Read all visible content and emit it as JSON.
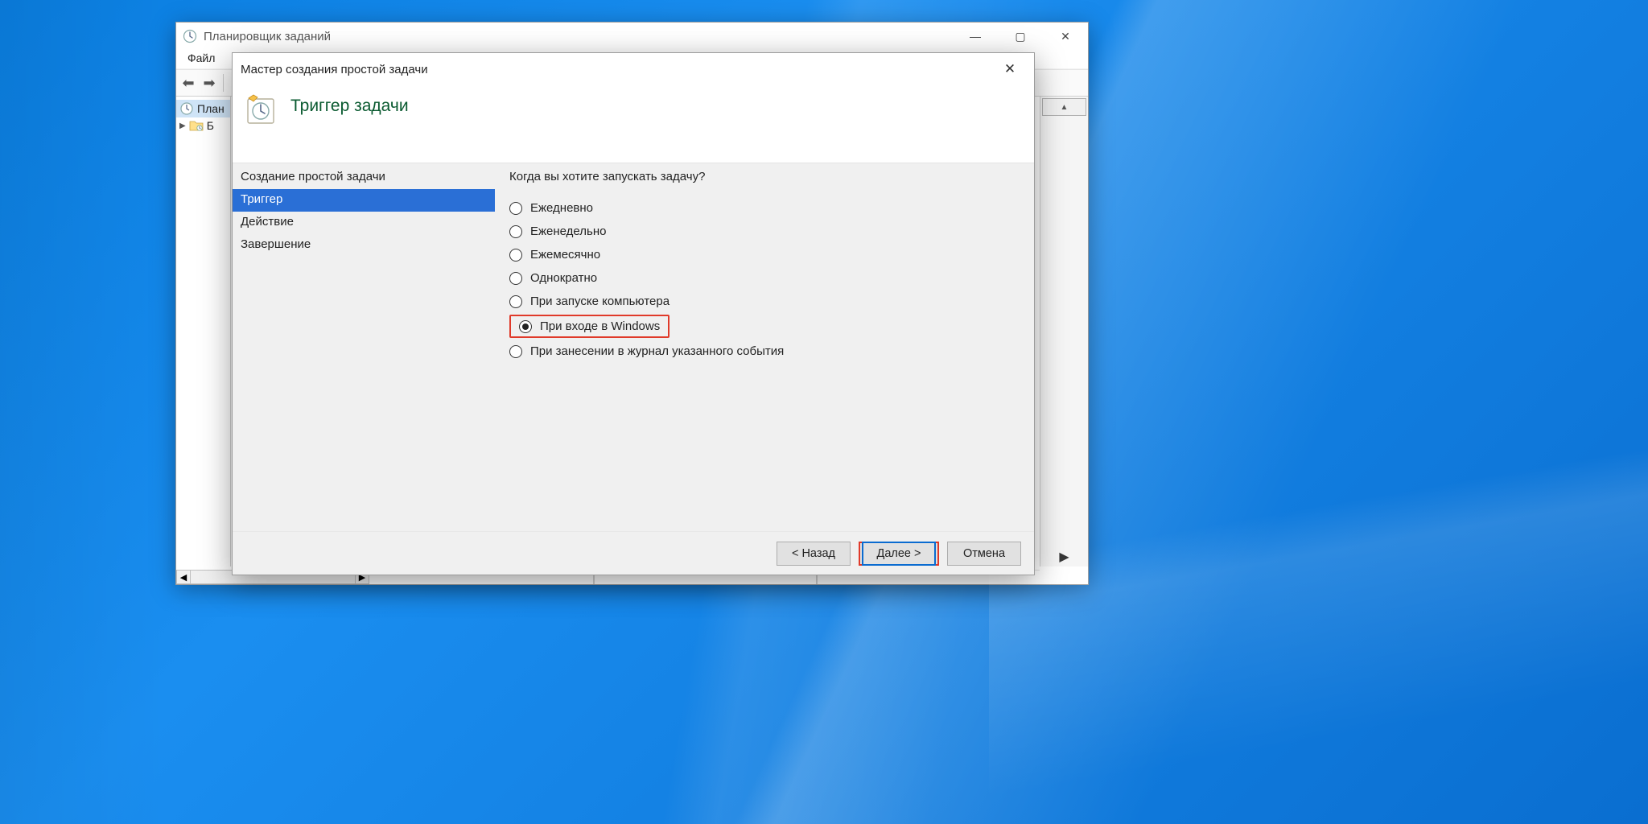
{
  "parent_window": {
    "title": "Планировщик заданий",
    "menu": {
      "file": "Файл"
    },
    "tree": {
      "item_root": "Планировщик заданий",
      "item_root_visible": "План",
      "item_lib": "Библиотека",
      "item_lib_visible": "Б"
    }
  },
  "wizard": {
    "title": "Мастер создания простой задачи",
    "header": "Триггер задачи",
    "nav": {
      "create": "Создание простой задачи",
      "trigger": "Триггер",
      "action": "Действие",
      "finish": "Завершение"
    },
    "question": "Когда вы хотите запускать задачу?",
    "options": {
      "daily": "Ежедневно",
      "weekly": "Еженедельно",
      "monthly": "Ежемесячно",
      "once": "Однократно",
      "startup": "При запуске компьютера",
      "logon": "При входе в Windows",
      "event": "При занесении в журнал указанного события"
    },
    "selected": "logon",
    "buttons": {
      "back": "< Назад",
      "next": "Далее >",
      "cancel": "Отмена"
    }
  }
}
